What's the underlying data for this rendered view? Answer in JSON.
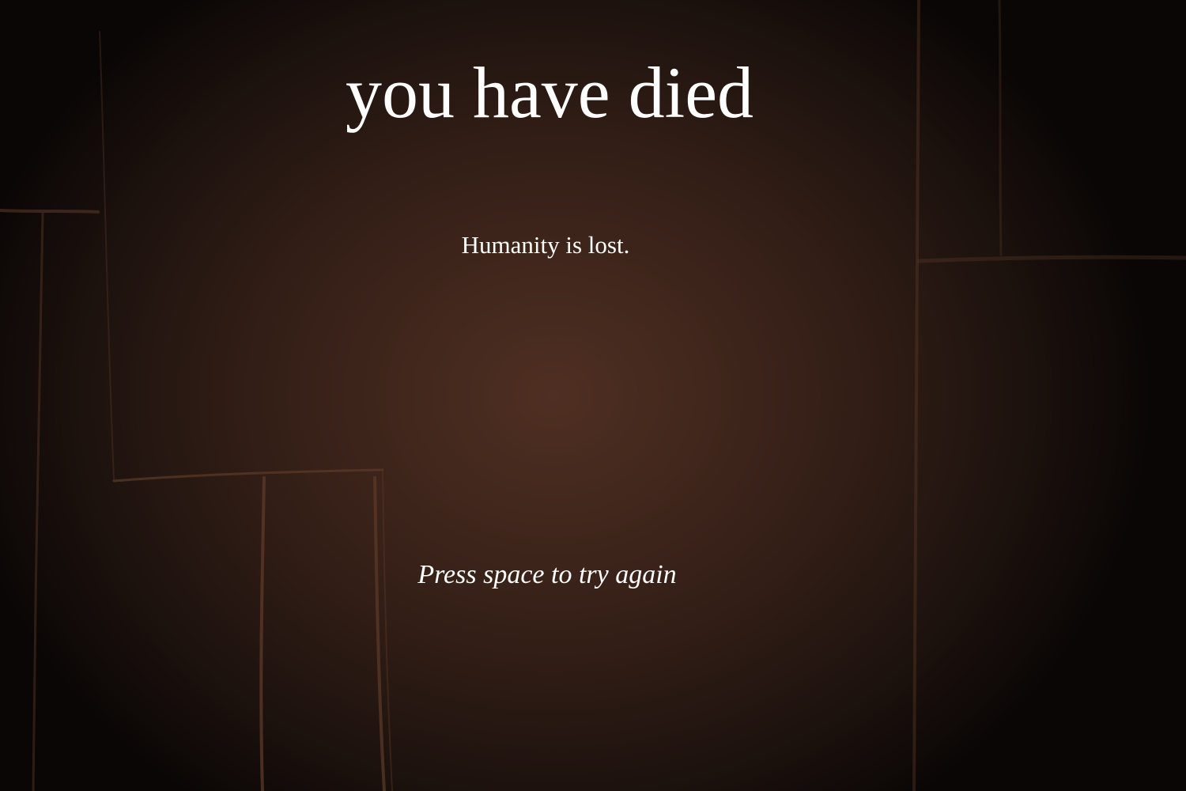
{
  "game_over": {
    "title": "you have died",
    "message": "Humanity is lost.",
    "prompt": "Press space to try again"
  },
  "colors": {
    "text": "#ffffff",
    "background_center": "#4f2f22",
    "background_edge": "#0a0605",
    "scratch_lines": "#5e3a28"
  }
}
